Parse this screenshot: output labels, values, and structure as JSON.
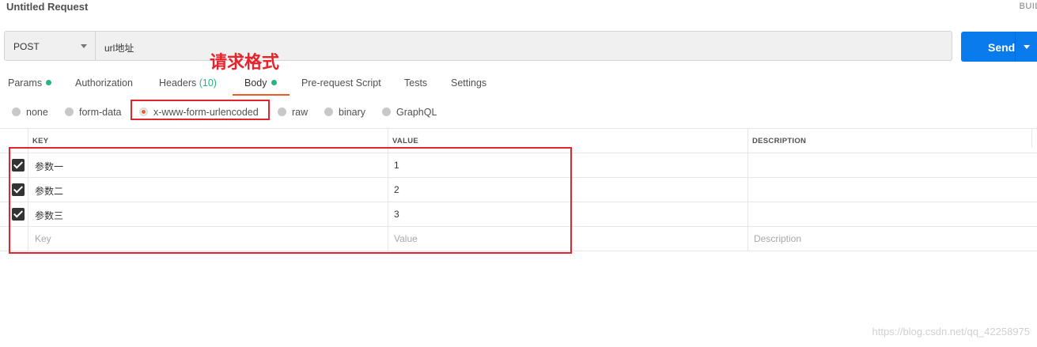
{
  "header": {
    "title": "Untitled Request",
    "build": "BUIL"
  },
  "request": {
    "method": "POST",
    "url": "url地址",
    "send_label": "Send"
  },
  "annotation": {
    "text": "请求格式",
    "color": "#e8232c"
  },
  "tabs": [
    {
      "label": "Params",
      "indicator": "dot"
    },
    {
      "label": "Authorization"
    },
    {
      "label": "Headers",
      "count": "(10)"
    },
    {
      "label": "Body",
      "indicator": "dot",
      "active": true
    },
    {
      "label": "Pre-request Script"
    },
    {
      "label": "Tests"
    },
    {
      "label": "Settings"
    }
  ],
  "body_types": [
    {
      "label": "none"
    },
    {
      "label": "form-data"
    },
    {
      "label": "x-www-form-urlencoded",
      "selected": true
    },
    {
      "label": "raw"
    },
    {
      "label": "binary"
    },
    {
      "label": "GraphQL"
    }
  ],
  "table": {
    "columns": [
      "KEY",
      "VALUE",
      "DESCRIPTION"
    ],
    "rows": [
      {
        "checked": true,
        "key": "参数一",
        "value": "1",
        "description": ""
      },
      {
        "checked": true,
        "key": "参数二",
        "value": "2",
        "description": ""
      },
      {
        "checked": true,
        "key": "参数三",
        "value": "3",
        "description": ""
      }
    ],
    "placeholders": {
      "key": "Key",
      "value": "Value",
      "description": "Description"
    }
  },
  "watermark": "https://blog.csdn.net/qq_42258975",
  "colors": {
    "accent": "#ef5b25",
    "send": "#097bed",
    "status_dot": "#26b47f",
    "highlight_box": "#e0252f"
  }
}
